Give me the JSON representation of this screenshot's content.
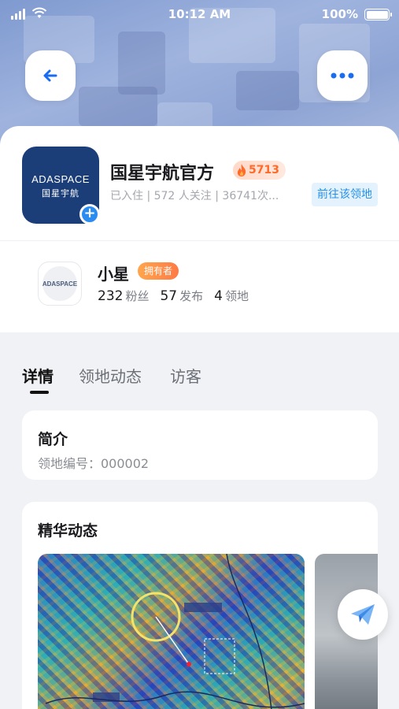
{
  "status_bar": {
    "time": "10:12 AM",
    "battery": "100%"
  },
  "header": {
    "back_icon": "arrow-left-icon",
    "more_icon": "ellipsis-icon"
  },
  "territory": {
    "logo_text": "ADASPACE",
    "logo_subtext": "国星宇航",
    "name": "国星宇航官方",
    "heat": "5713",
    "meta": "已入住 | 572 人关注 | 36741次...",
    "goto_label": "前往该领地"
  },
  "owner": {
    "avatar_text": "ADASPACE",
    "name": "小星",
    "badge": "拥有者",
    "stats": [
      {
        "value": "232",
        "label": "粉丝"
      },
      {
        "value": "57",
        "label": "发布"
      },
      {
        "value": "4",
        "label": "领地"
      }
    ]
  },
  "tabs": [
    {
      "label": "详情",
      "active": true
    },
    {
      "label": "领地动态",
      "active": false
    },
    {
      "label": "访客",
      "active": false
    }
  ],
  "intro": {
    "title": "简介",
    "subtitle": "领地编号：000002"
  },
  "featured": {
    "title": "精华动态"
  },
  "colors": {
    "accent": "#2790e6",
    "brand": "#1b3e78",
    "hot": "#ff6a2a"
  }
}
